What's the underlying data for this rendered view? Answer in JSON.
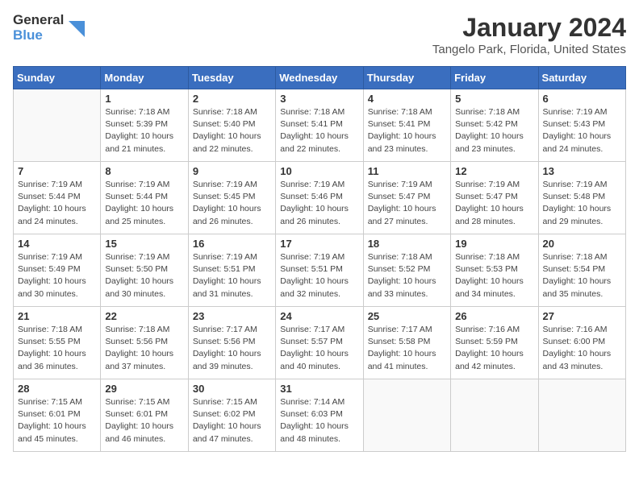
{
  "logo": {
    "line1": "General",
    "line2": "Blue"
  },
  "title": "January 2024",
  "subtitle": "Tangelo Park, Florida, United States",
  "weekdays": [
    "Sunday",
    "Monday",
    "Tuesday",
    "Wednesday",
    "Thursday",
    "Friday",
    "Saturday"
  ],
  "weeks": [
    [
      {
        "day": null,
        "info": null
      },
      {
        "day": "1",
        "info": "Sunrise: 7:18 AM\nSunset: 5:39 PM\nDaylight: 10 hours\nand 21 minutes."
      },
      {
        "day": "2",
        "info": "Sunrise: 7:18 AM\nSunset: 5:40 PM\nDaylight: 10 hours\nand 22 minutes."
      },
      {
        "day": "3",
        "info": "Sunrise: 7:18 AM\nSunset: 5:41 PM\nDaylight: 10 hours\nand 22 minutes."
      },
      {
        "day": "4",
        "info": "Sunrise: 7:18 AM\nSunset: 5:41 PM\nDaylight: 10 hours\nand 23 minutes."
      },
      {
        "day": "5",
        "info": "Sunrise: 7:18 AM\nSunset: 5:42 PM\nDaylight: 10 hours\nand 23 minutes."
      },
      {
        "day": "6",
        "info": "Sunrise: 7:19 AM\nSunset: 5:43 PM\nDaylight: 10 hours\nand 24 minutes."
      }
    ],
    [
      {
        "day": "7",
        "info": "Sunrise: 7:19 AM\nSunset: 5:44 PM\nDaylight: 10 hours\nand 24 minutes."
      },
      {
        "day": "8",
        "info": "Sunrise: 7:19 AM\nSunset: 5:44 PM\nDaylight: 10 hours\nand 25 minutes."
      },
      {
        "day": "9",
        "info": "Sunrise: 7:19 AM\nSunset: 5:45 PM\nDaylight: 10 hours\nand 26 minutes."
      },
      {
        "day": "10",
        "info": "Sunrise: 7:19 AM\nSunset: 5:46 PM\nDaylight: 10 hours\nand 26 minutes."
      },
      {
        "day": "11",
        "info": "Sunrise: 7:19 AM\nSunset: 5:47 PM\nDaylight: 10 hours\nand 27 minutes."
      },
      {
        "day": "12",
        "info": "Sunrise: 7:19 AM\nSunset: 5:47 PM\nDaylight: 10 hours\nand 28 minutes."
      },
      {
        "day": "13",
        "info": "Sunrise: 7:19 AM\nSunset: 5:48 PM\nDaylight: 10 hours\nand 29 minutes."
      }
    ],
    [
      {
        "day": "14",
        "info": "Sunrise: 7:19 AM\nSunset: 5:49 PM\nDaylight: 10 hours\nand 30 minutes."
      },
      {
        "day": "15",
        "info": "Sunrise: 7:19 AM\nSunset: 5:50 PM\nDaylight: 10 hours\nand 30 minutes."
      },
      {
        "day": "16",
        "info": "Sunrise: 7:19 AM\nSunset: 5:51 PM\nDaylight: 10 hours\nand 31 minutes."
      },
      {
        "day": "17",
        "info": "Sunrise: 7:19 AM\nSunset: 5:51 PM\nDaylight: 10 hours\nand 32 minutes."
      },
      {
        "day": "18",
        "info": "Sunrise: 7:18 AM\nSunset: 5:52 PM\nDaylight: 10 hours\nand 33 minutes."
      },
      {
        "day": "19",
        "info": "Sunrise: 7:18 AM\nSunset: 5:53 PM\nDaylight: 10 hours\nand 34 minutes."
      },
      {
        "day": "20",
        "info": "Sunrise: 7:18 AM\nSunset: 5:54 PM\nDaylight: 10 hours\nand 35 minutes."
      }
    ],
    [
      {
        "day": "21",
        "info": "Sunrise: 7:18 AM\nSunset: 5:55 PM\nDaylight: 10 hours\nand 36 minutes."
      },
      {
        "day": "22",
        "info": "Sunrise: 7:18 AM\nSunset: 5:56 PM\nDaylight: 10 hours\nand 37 minutes."
      },
      {
        "day": "23",
        "info": "Sunrise: 7:17 AM\nSunset: 5:56 PM\nDaylight: 10 hours\nand 39 minutes."
      },
      {
        "day": "24",
        "info": "Sunrise: 7:17 AM\nSunset: 5:57 PM\nDaylight: 10 hours\nand 40 minutes."
      },
      {
        "day": "25",
        "info": "Sunrise: 7:17 AM\nSunset: 5:58 PM\nDaylight: 10 hours\nand 41 minutes."
      },
      {
        "day": "26",
        "info": "Sunrise: 7:16 AM\nSunset: 5:59 PM\nDaylight: 10 hours\nand 42 minutes."
      },
      {
        "day": "27",
        "info": "Sunrise: 7:16 AM\nSunset: 6:00 PM\nDaylight: 10 hours\nand 43 minutes."
      }
    ],
    [
      {
        "day": "28",
        "info": "Sunrise: 7:15 AM\nSunset: 6:01 PM\nDaylight: 10 hours\nand 45 minutes."
      },
      {
        "day": "29",
        "info": "Sunrise: 7:15 AM\nSunset: 6:01 PM\nDaylight: 10 hours\nand 46 minutes."
      },
      {
        "day": "30",
        "info": "Sunrise: 7:15 AM\nSunset: 6:02 PM\nDaylight: 10 hours\nand 47 minutes."
      },
      {
        "day": "31",
        "info": "Sunrise: 7:14 AM\nSunset: 6:03 PM\nDaylight: 10 hours\nand 48 minutes."
      },
      {
        "day": null,
        "info": null
      },
      {
        "day": null,
        "info": null
      },
      {
        "day": null,
        "info": null
      }
    ]
  ]
}
